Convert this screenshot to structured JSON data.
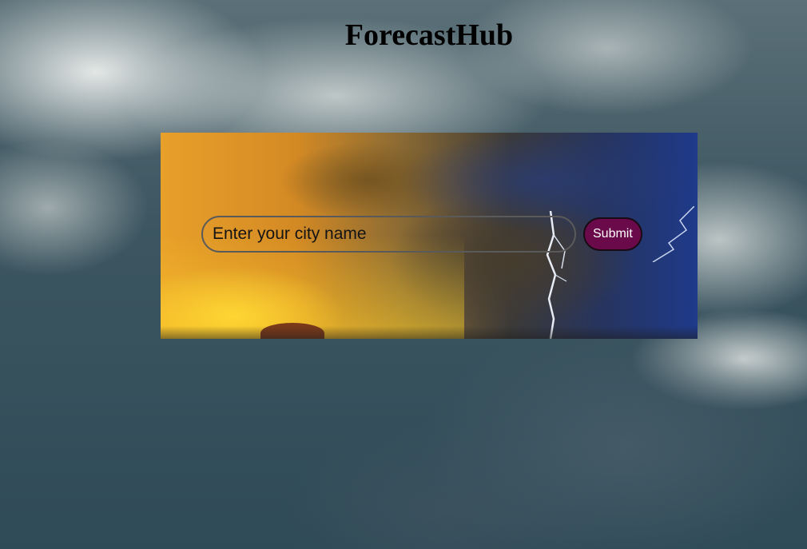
{
  "header": {
    "title": "ForecastHub"
  },
  "search": {
    "placeholder": "Enter your city name",
    "value": "",
    "submit_label": "Submit"
  },
  "colors": {
    "submit_button": "#6a0a4a",
    "title_text": "#000000"
  }
}
